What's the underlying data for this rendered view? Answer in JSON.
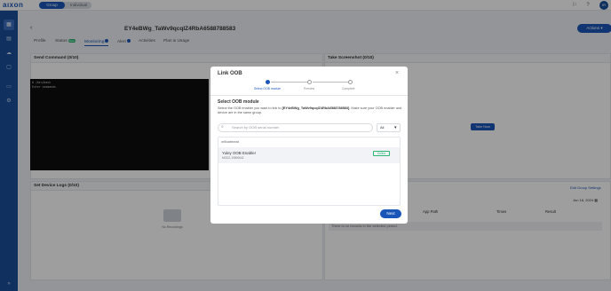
{
  "app": {
    "logo": "aıxon",
    "mode_on": "Group",
    "mode_off": "Individual",
    "avatar": "IR"
  },
  "header": {
    "back": "‹",
    "device_title": "EY4eBWg_TaWv9qcqIZ4RbA6588788583",
    "actions": "Actions ▾"
  },
  "tabs": [
    {
      "label": "Profile"
    },
    {
      "label": "Status",
      "badge": "New"
    },
    {
      "label": "Monitoring"
    },
    {
      "label": "Alert"
    },
    {
      "label": "Activities"
    },
    {
      "label": "Plan & Usage"
    }
  ],
  "panels": {
    "send_command": "Send Command (0/10)",
    "take_screenshot": "Take Screenshot (0/10)",
    "device_logs": "Set Device Logs (0/10)"
  },
  "console": {
    "line1": "# /bin/bash",
    "line2": "Enter commands"
  },
  "take_now": "Take Now",
  "edit_settings": "Edit Group Settings",
  "date": "Jun 18, 2024",
  "logs_table": {
    "col1": "App Path",
    "col2": "Times",
    "col3": "Result",
    "empty": "There is no records in the selected period."
  },
  "no_recordings": "No Recordings",
  "modal": {
    "title": "Link OOB",
    "close": "×",
    "steps": [
      "Select OOB module",
      "Preview",
      "Complete"
    ],
    "section_title": "Select OOB module",
    "desc_pre": "Select the OOB enabler you want to link to ",
    "desc_device": "[EY4eBWg_TaWv9qcqIZ4RbA6588788583]",
    "desc_post": ". Make sure your OOB enabler and device are in the same group.",
    "search_placeholder": "Search by OOB serial number",
    "filter_value": "All",
    "list_header": "mfloatmeat",
    "item": {
      "name": "Yuley OOB Enabler",
      "serial": "MOD2-19800642",
      "status": "Online"
    },
    "next": "Next"
  }
}
